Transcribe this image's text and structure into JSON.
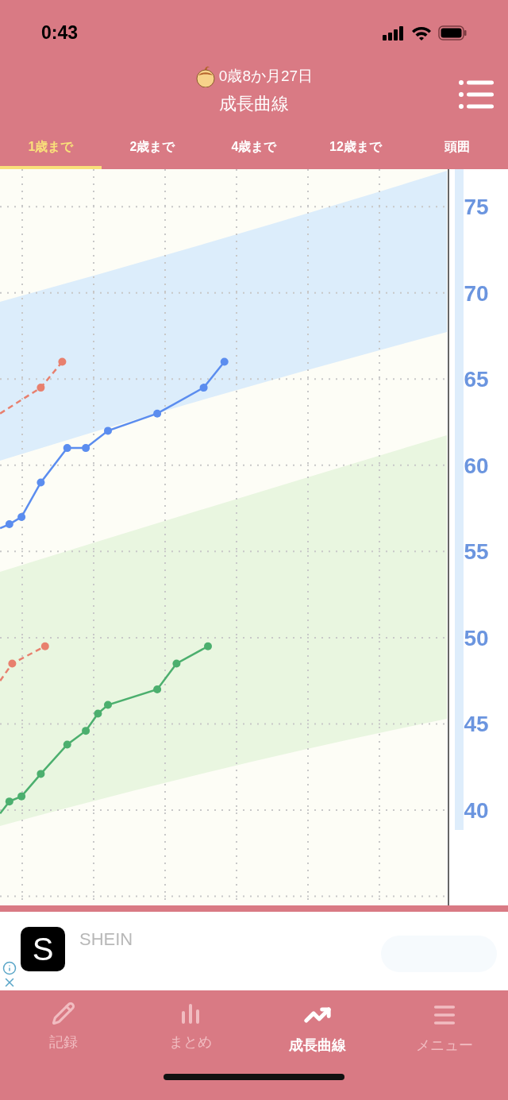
{
  "status_bar": {
    "time": "0:43"
  },
  "header": {
    "age": "0歳8か月27日",
    "title": "成長曲線"
  },
  "tabs": [
    {
      "label": "1歳まで",
      "selected": true
    },
    {
      "label": "2歳まで",
      "selected": false
    },
    {
      "label": "4歳まで",
      "selected": false
    },
    {
      "label": "12歳まで",
      "selected": false
    },
    {
      "label": "頭囲",
      "selected": false
    }
  ],
  "chart": {
    "axis_labels": [
      "75",
      "70",
      "65",
      "60",
      "55",
      "50",
      "45",
      "40"
    ]
  },
  "ad": {
    "logo": "S",
    "title": "SHEIN"
  },
  "bottom_nav": [
    {
      "kind": "record",
      "label": "記録",
      "selected": false
    },
    {
      "kind": "summary",
      "label": "まとめ",
      "selected": false
    },
    {
      "kind": "growth",
      "label": "成長曲線",
      "selected": true
    },
    {
      "kind": "menu",
      "label": "メニュー",
      "selected": false
    }
  ]
}
